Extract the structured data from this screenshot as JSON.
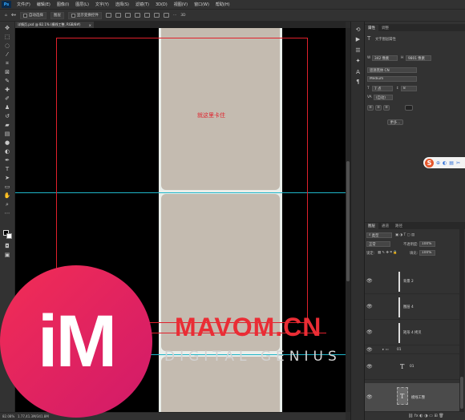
{
  "menubar": {
    "logo": "Ps",
    "items": [
      "文件(F)",
      "编辑(E)",
      "图像(I)",
      "图层(L)",
      "文字(Y)",
      "选择(S)",
      "滤镜(T)",
      "3D(D)",
      "视图(V)",
      "窗口(W)",
      "帮助(H)"
    ]
  },
  "options": {
    "auto_select": "自动选择",
    "auto_select_target": "图层",
    "show_transform": "显示变换控件"
  },
  "document": {
    "tab_title": "详情页.psd @ 82.1% (模线工整, RGB/8#)",
    "tab_close": "×"
  },
  "canvas": {
    "card_text": "就这里卡住"
  },
  "status": {
    "zoom": "82.08%",
    "size": "1.77,41.3M/341.8M"
  },
  "properties": {
    "tabs": [
      "属性",
      "调整"
    ],
    "heading": "文字图层属性",
    "w_label": "W",
    "w_value": "342 像素",
    "h_label": "H",
    "h_value": "9801 像素",
    "font_family": "思源黑体 CN",
    "font_style": "Medium",
    "font_size": "7 点",
    "leading": "8",
    "tracking": "(自动)",
    "more_button": "更多..."
  },
  "layers": {
    "tabs": [
      "图层",
      "通道",
      "路径"
    ],
    "filter_kind": "类型",
    "blend_mode": "正常",
    "opacity_label": "不透明度:",
    "opacity_value": "100%",
    "lock_label": "锁定:",
    "fill_label": "填充:",
    "fill_value": "100%",
    "rows": [
      {
        "name": "背景 2",
        "kind": "shape"
      },
      {
        "name": "图层 4",
        "kind": "shape"
      },
      {
        "name": "矩形 4 拷贝",
        "kind": "shape"
      },
      {
        "name": "01",
        "kind": "group"
      },
      {
        "name": "01",
        "kind": "text"
      },
      {
        "name": "模线工整",
        "kind": "text"
      }
    ]
  },
  "watermark": {
    "logo": "iM",
    "title": "MAVOM.CN",
    "subtitle": "DIGITAL GENIUS"
  },
  "colors": {
    "app_bg": "#323232",
    "canvas_bg": "#000000",
    "card": "#c4bbb0",
    "guide": "#1fb6c9",
    "frame": "#e0202b",
    "watermark_red": "#ea2d35"
  }
}
